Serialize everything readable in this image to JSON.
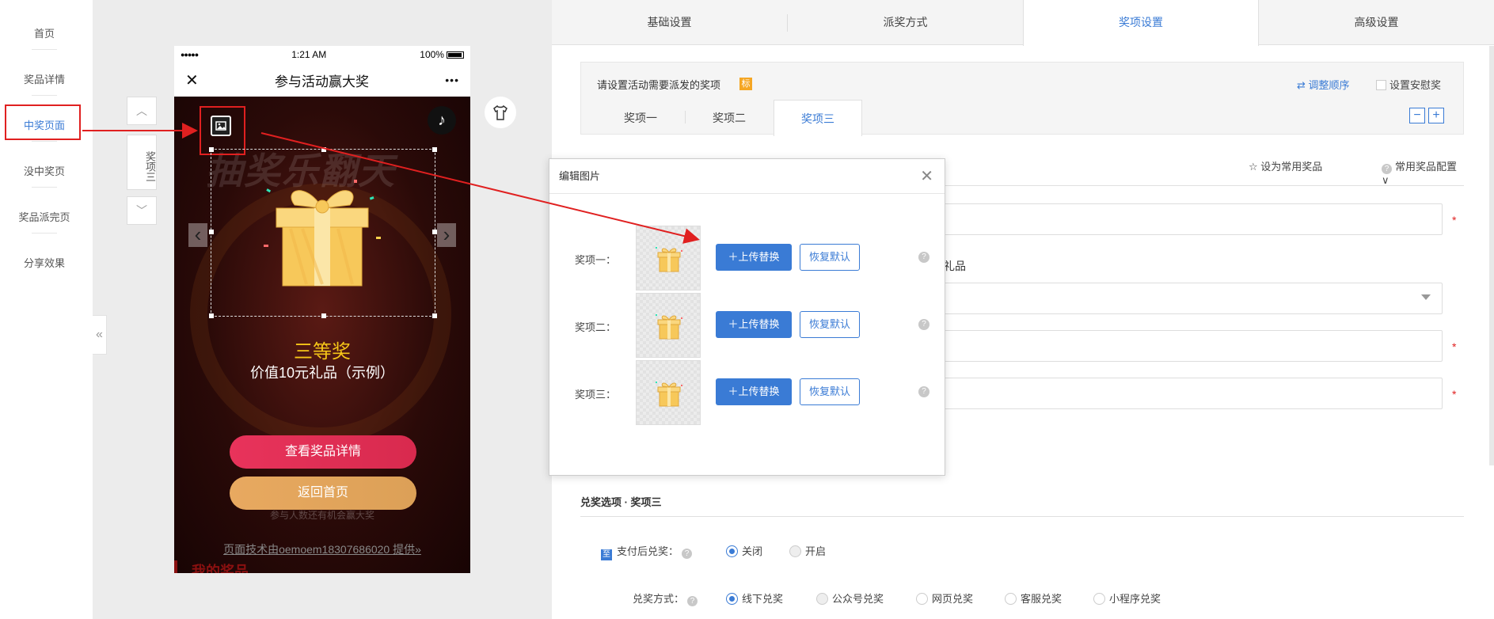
{
  "leftnav": {
    "items": [
      {
        "label": "首页"
      },
      {
        "label": "奖品详情"
      },
      {
        "label": "中奖页面"
      },
      {
        "label": "没中奖页"
      },
      {
        "label": "奖品派完页"
      },
      {
        "label": "分享效果"
      }
    ],
    "active_index": 2,
    "collapse_glyph": "«"
  },
  "preview": {
    "side_tab": "奖项三",
    "up_glyph": "︿",
    "down_glyph": "﹀",
    "shirt_icon": "shirt-icon"
  },
  "phone": {
    "status": {
      "signal": "●●●●●",
      "time": "1:21 AM",
      "battery": "100%"
    },
    "nav": {
      "close": "✕",
      "title": "参与活动赢大奖",
      "more": "•••"
    },
    "bg_title": "抽奖乐翻天",
    "music_glyph": "♪",
    "prize_name": "三等奖",
    "prize_value": "价值10元礼品（示例）",
    "btn_detail": "查看奖品详情",
    "btn_home": "返回首页",
    "faint_text": "参与人数还有机会赢大奖",
    "tech": "页面技术由oemoem18307686020 提供»",
    "my_prize": "我的奖品"
  },
  "right": {
    "tabs": [
      {
        "label": "基础设置"
      },
      {
        "label": "派奖方式"
      },
      {
        "label": "奖项设置"
      },
      {
        "label": "高级设置"
      }
    ],
    "active_tab": 2,
    "prize_box": {
      "title": "请设置活动需要派发的奖项",
      "tag": "标",
      "sort": "⇄ 调整顺序",
      "consolation": "设置安慰奖",
      "subtabs": [
        {
          "label": "奖项一"
        },
        {
          "label": "奖项二"
        },
        {
          "label": "奖项三"
        }
      ],
      "active_subtab": 2,
      "minus": "−",
      "plus": "+"
    },
    "fav": "☆ 设为常用奖品",
    "fav_cfg": "常用奖品配置 ∨",
    "gift_tail": "礼品",
    "required_mark": "*",
    "section_title": "兑奖选项 · 奖项三",
    "pay_label": "支付后兑奖：",
    "pay_icon": "至",
    "pay_options": [
      {
        "label": "关闭",
        "checked": true
      },
      {
        "label": "开启",
        "checked": false
      }
    ],
    "method_label": "兑奖方式：",
    "method_options": [
      {
        "label": "线下兑奖",
        "checked": true
      },
      {
        "label": "公众号兑奖",
        "checked": false
      },
      {
        "label": "网页兑奖",
        "checked": false
      },
      {
        "label": "客服兑奖",
        "checked": false
      },
      {
        "label": "小程序兑奖",
        "checked": false
      }
    ],
    "help_glyph": "?"
  },
  "modal": {
    "title": "编辑图片",
    "close": "✕",
    "rows": [
      {
        "label": "奖项一：",
        "upload": "＋上传替换",
        "restore": "恢复默认"
      },
      {
        "label": "奖项二：",
        "upload": "＋上传替换",
        "restore": "恢复默认"
      },
      {
        "label": "奖项三：",
        "upload": "＋上传替换",
        "restore": "恢复默认"
      }
    ],
    "help_glyph": "?"
  },
  "colors": {
    "accent": "#3a7bd5",
    "annotation": "#e02020",
    "prize_gold": "#f5c518",
    "button_red": "#e8335b",
    "button_gold": "#e8a960"
  }
}
